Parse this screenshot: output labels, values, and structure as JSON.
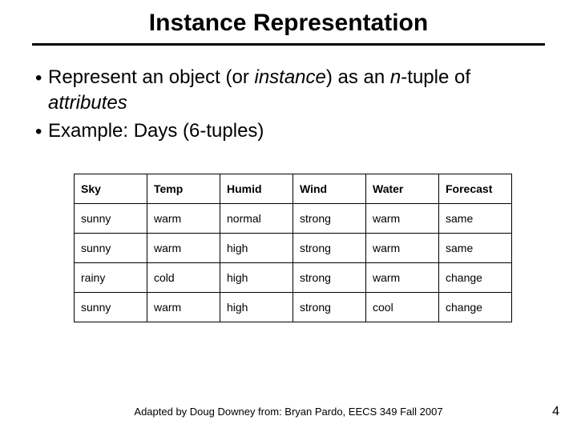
{
  "title": "Instance Representation",
  "bullets": {
    "b1_pre": "Represent an object (or ",
    "b1_em1": "instance",
    "b1_mid": ") as an ",
    "b1_em2": "n",
    "b1_mid2": "-tuple of ",
    "b1_em3": "attributes",
    "b2": "Example: Days (6-tuples)"
  },
  "table": {
    "headers": [
      "Sky",
      "Temp",
      "Humid",
      "Wind",
      "Water",
      "Forecast"
    ],
    "rows": [
      [
        "sunny",
        "warm",
        "normal",
        "strong",
        "warm",
        "same"
      ],
      [
        "sunny",
        "warm",
        "high",
        "strong",
        "warm",
        "same"
      ],
      [
        "rainy",
        "cold",
        "high",
        "strong",
        "warm",
        "change"
      ],
      [
        "sunny",
        "warm",
        "high",
        "strong",
        "cool",
        "change"
      ]
    ]
  },
  "footer": "Adapted by Doug Downey from: Bryan Pardo, EECS 349 Fall 2007",
  "page_number": "4"
}
